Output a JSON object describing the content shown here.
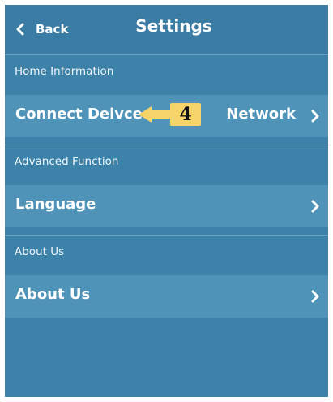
{
  "header": {
    "back_label": "Back",
    "title": "Settings"
  },
  "sections": [
    {
      "title": "Home Information",
      "row": {
        "label": "Connect Deivce",
        "value": "Network"
      }
    },
    {
      "title": "Advanced Function",
      "row": {
        "label": "Language",
        "value": ""
      }
    },
    {
      "title": "About Us",
      "row": {
        "label": "About Us",
        "value": ""
      }
    }
  ],
  "annotation": {
    "step_number": "4"
  },
  "colors": {
    "background": "#3d82a9",
    "row": "#4f93b8",
    "callout": "#f6d46a"
  },
  "icons": [
    "chevron-left-icon",
    "chevron-right-icon",
    "arrow-left-icon"
  ]
}
